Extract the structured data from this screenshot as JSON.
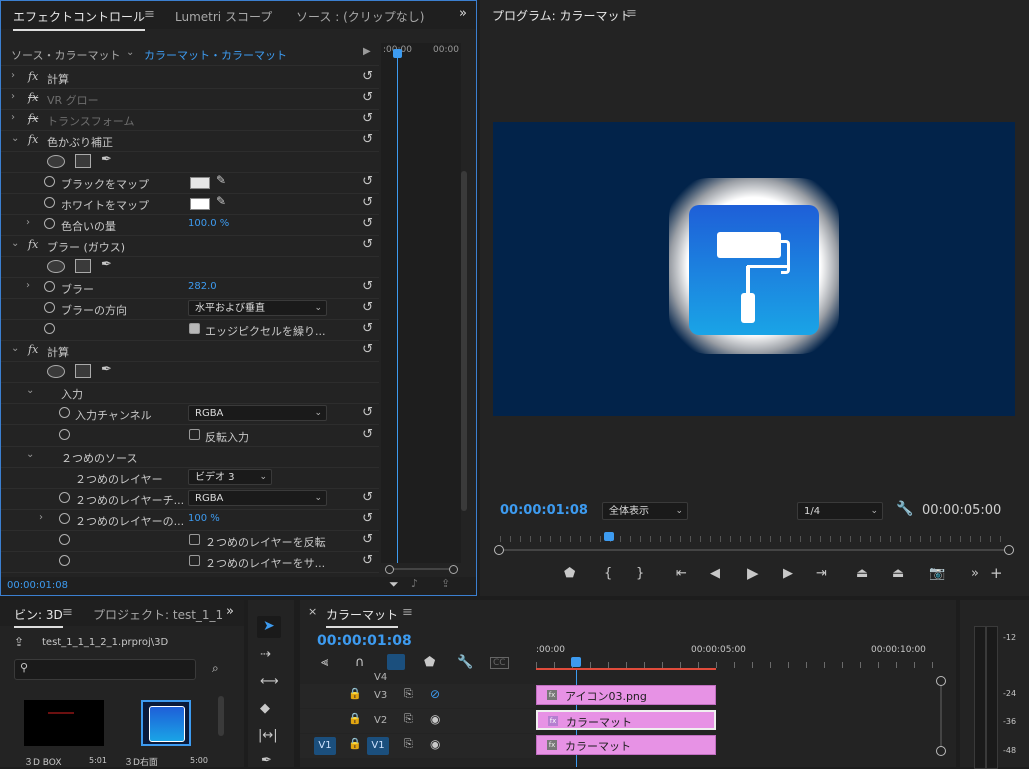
{
  "effect_controls": {
    "tabs": [
      "エフェクトコントロール",
      "Lumetri スコープ",
      "ソース : (クリップなし)"
    ],
    "source_label": "ソース・カラーマット",
    "clip_label": "カラーマット・カラーマット",
    "timecode_ruler": [
      ":00:00",
      "00:00"
    ],
    "rows": {
      "calc1": "計算",
      "vr_glow": "VR グロー",
      "transform": "トランスフォーム",
      "tint": "色かぶり補正",
      "map_black": "ブラックをマップ",
      "map_white": "ホワイトをマップ",
      "tint_amount": "色合いの量",
      "tint_amount_value": "100.0 %",
      "blur": "ブラー (ガウス)",
      "blurriness": "ブラー",
      "blurriness_value": "282.0",
      "blur_dir": "ブラーの方向",
      "blur_dir_value": "水平および垂直",
      "edge_pixels": "エッジピクセルを繰り...",
      "calc2": "計算",
      "input": "入力",
      "input_channel": "入力チャンネル",
      "input_channel_value": "RGBA",
      "invert_input": "反転入力",
      "second_source": "２つめのソース",
      "second_layer": "２つめのレイヤー",
      "second_layer_value": "ビデオ 3",
      "second_layer_ch": "２つめのレイヤーチ...",
      "second_layer_ch_value": "RGBA",
      "second_layer_opacity": "２つめのレイヤーの...",
      "second_layer_opacity_value": "100 %",
      "invert_second": "２つめのレイヤーを反転",
      "second_layer_size": "２つめのレイヤーをサ..."
    },
    "timecode": "00:00:01:08"
  },
  "program": {
    "title": "プログラム: カラーマット",
    "timecode": "00:00:01:08",
    "fit": "全体表示",
    "resolution": "1/4",
    "duration": "00:00:05:00"
  },
  "bin": {
    "tabs": [
      "ビン: 3D",
      "プロジェクト: test_1_1"
    ],
    "path": "test_1_1_1_2_1.prproj\\3D",
    "items": [
      {
        "name": "３D BOX",
        "duration": "5:01"
      },
      {
        "name": "３D右面",
        "duration": "5:00"
      }
    ]
  },
  "timeline": {
    "title": "カラーマット",
    "timecode": "00:00:01:08",
    "ruler": [
      ":00:00",
      "00:00:05:00",
      "00:00:10:00"
    ],
    "tracks": [
      {
        "name": "V4"
      },
      {
        "name": "V3"
      },
      {
        "name": "V2"
      },
      {
        "name": "V1"
      }
    ],
    "source_patch": "V1",
    "clips": {
      "v3": "アイコン03.png",
      "v2": "カラーマット",
      "v1": "カラーマット"
    }
  },
  "audio_meter": {
    "scale": [
      "-12",
      "-24",
      "-36",
      "-48"
    ]
  }
}
